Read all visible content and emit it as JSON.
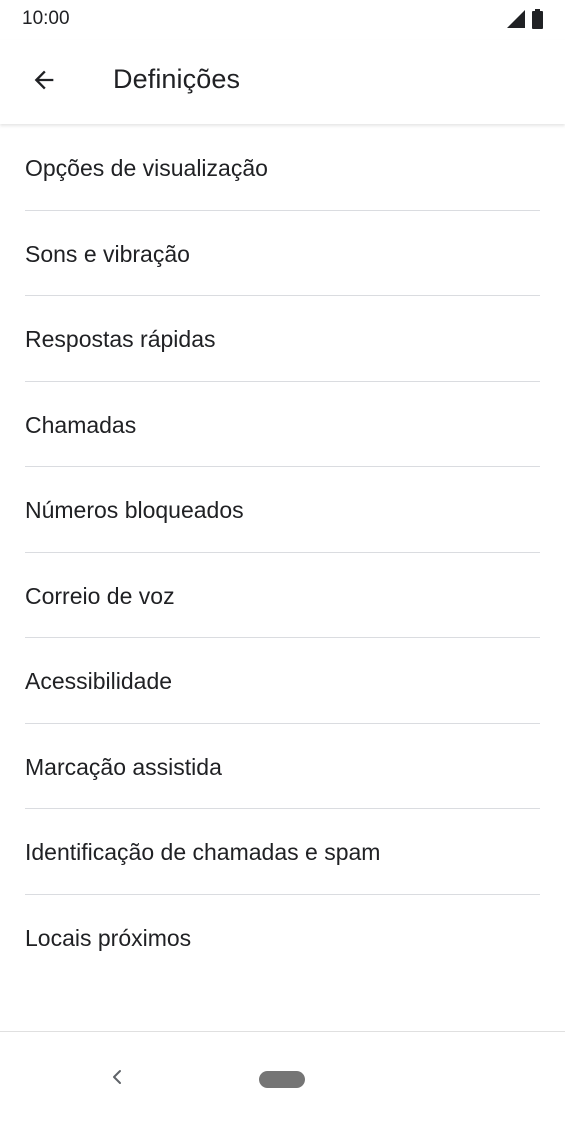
{
  "status_bar": {
    "time": "10:00"
  },
  "app_bar": {
    "title": "Definições",
    "back_icon": "arrow-back-icon"
  },
  "settings": {
    "items": [
      {
        "label": "Opções de visualização"
      },
      {
        "label": "Sons e vibração"
      },
      {
        "label": "Respostas rápidas"
      },
      {
        "label": "Chamadas"
      },
      {
        "label": "Números bloqueados"
      },
      {
        "label": "Correio de voz"
      },
      {
        "label": "Acessibilidade"
      },
      {
        "label": "Marcação assistida"
      },
      {
        "label": "Identificação de chamadas e spam"
      },
      {
        "label": "Locais próximos"
      }
    ]
  },
  "nav_bar": {
    "back_icon": "nav-back-icon",
    "home_icon": "home-pill-icon"
  },
  "colors": {
    "text": "#202124",
    "divider": "#dadce0",
    "background": "#ffffff"
  }
}
